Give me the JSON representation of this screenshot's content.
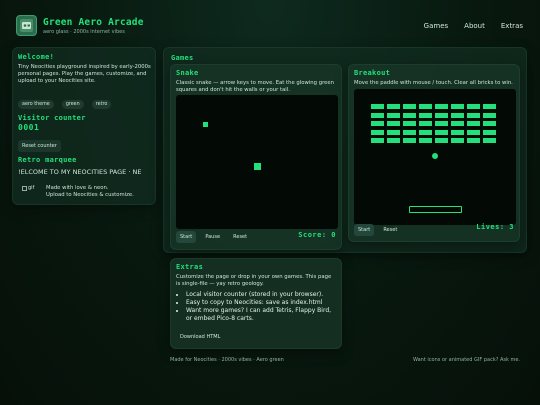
{
  "header": {
    "title": "Green Aero Arcade",
    "subtitle": "aero glass · 2000s internet vibes",
    "nav": [
      "Games",
      "About",
      "Extras"
    ]
  },
  "sidebar": {
    "welcome_title": "Welcome!",
    "welcome_text": "Tiny Neocities playground inspired by early-2000s personal pages. Play the games, customize, and upload to your Neocities site.",
    "chips": [
      "aero theme",
      "green",
      "retro"
    ],
    "counter_title": "Visitor counter",
    "counter_value": "0001",
    "reset_label": "Reset counter",
    "marquee_title": "Retro marquee",
    "marquee_text": "!ELCOME TO MY NEOCITIES PAGE  ·  NE",
    "gif_alt": "gif",
    "made_with": "Made with love & neon.",
    "upload_note": "Upload to Neocities & customize."
  },
  "games": {
    "section_title": "Games",
    "snake": {
      "title": "Snake",
      "desc": "Classic snake — arrow keys to move. Eat the glowing green squares and don't hit the walls or your tail.",
      "score_label": "Score: 0",
      "buttons": [
        "Start",
        "Pause",
        "Reset"
      ]
    },
    "breakout": {
      "title": "Breakout",
      "desc": "Move the paddle with mouse / touch. Clear all bricks to win.",
      "lives_label": "Lives: 3",
      "buttons": [
        "Start",
        "Reset"
      ]
    }
  },
  "extras": {
    "title": "Extras",
    "desc": "Customize the page or drop in your own games. This page is single-file — yay retro geology.",
    "bullets": [
      "Local visitor counter (stored in your browser).",
      "Easy to copy to Neocities: save as index.html",
      "Want more games? I can add Tetris, Flappy Bird, or embed Pico-8 carts."
    ],
    "download_label": "Download HTML"
  },
  "footer": {
    "left": "Made for Neocities · 2000s vibes · Aero green",
    "right": "Want icons or animated GIF pack? Ask me."
  },
  "colors": {
    "accent": "#22e07a",
    "panel": "#122c20",
    "background": "#08180f"
  }
}
